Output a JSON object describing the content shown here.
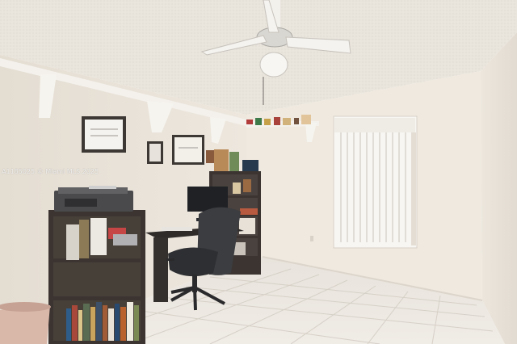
{
  "photo": {
    "watermark": "A1185025 © Miami MLS 2025"
  },
  "colors": {
    "ceiling": "#e9e4dc",
    "wall_left": "#ece6dd",
    "wall_back": "#efe9df",
    "wall_right": "#e6e0d6",
    "floor_tile": "#ebe6df",
    "grout": "#d5cfc6",
    "shelf_wood": "#3b3431",
    "chair": "#3c3d40",
    "printer": "#4a4a4c"
  },
  "icons": [
    "ceiling-fan",
    "office-chair",
    "monitor",
    "printer",
    "bookcase",
    "window-blinds",
    "framed-certificate",
    "wastebasket"
  ]
}
